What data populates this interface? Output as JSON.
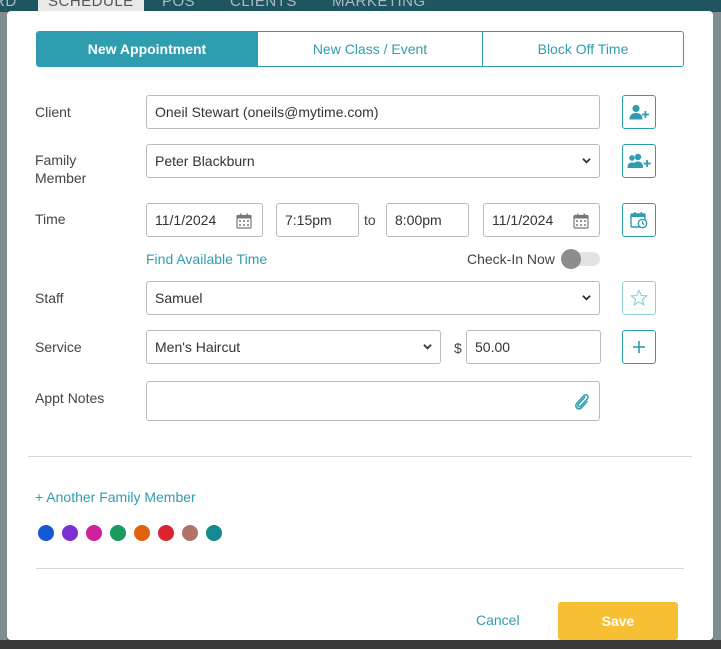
{
  "background_nav": {
    "tabs": [
      "RD",
      "SCHEDULE",
      "POS",
      "CLIENTS",
      "MARKETING"
    ],
    "active_tab": "SCHEDULE"
  },
  "modal": {
    "tabs": [
      {
        "label": "New Appointment",
        "active": true
      },
      {
        "label": "New Class / Event",
        "active": false
      },
      {
        "label": "Block Off Time",
        "active": false
      }
    ],
    "client": {
      "label": "Client",
      "value": "Oneil Stewart (oneils@mytime.com)",
      "add_icon": "add-client-icon"
    },
    "family_member": {
      "label": "Family Member",
      "value": "Peter Blackburn",
      "add_icon": "add-family-icon"
    },
    "time": {
      "label": "Time",
      "start_date": "11/1/2024",
      "start_time": "7:15pm",
      "to_label": "to",
      "end_time": "8:00pm",
      "end_date": "11/1/2024",
      "recurring_icon": "calendar-repeat-icon"
    },
    "find_time_link": "Find Available Time",
    "check_in": {
      "label": "Check-In Now",
      "on": false
    },
    "staff": {
      "label": "Staff",
      "value": "Samuel",
      "favorite_icon": "star-icon"
    },
    "service": {
      "label": "Service",
      "value": "Men's Haircut",
      "currency": "$",
      "price": "50.00",
      "add_icon": "plus-icon"
    },
    "notes": {
      "label": "Appt Notes",
      "value": "",
      "attach_icon": "paperclip-icon"
    },
    "another_family_link": "+ Another Family Member",
    "colors": [
      "#1558d6",
      "#7d2fd0",
      "#d21f9e",
      "#1a9a5c",
      "#e0620d",
      "#dc2430",
      "#b07466",
      "#138a8f"
    ],
    "cancel_label": "Cancel",
    "save_label": "Save"
  },
  "theme": {
    "accent": "#2f9db0",
    "save": "#f7bf33"
  }
}
